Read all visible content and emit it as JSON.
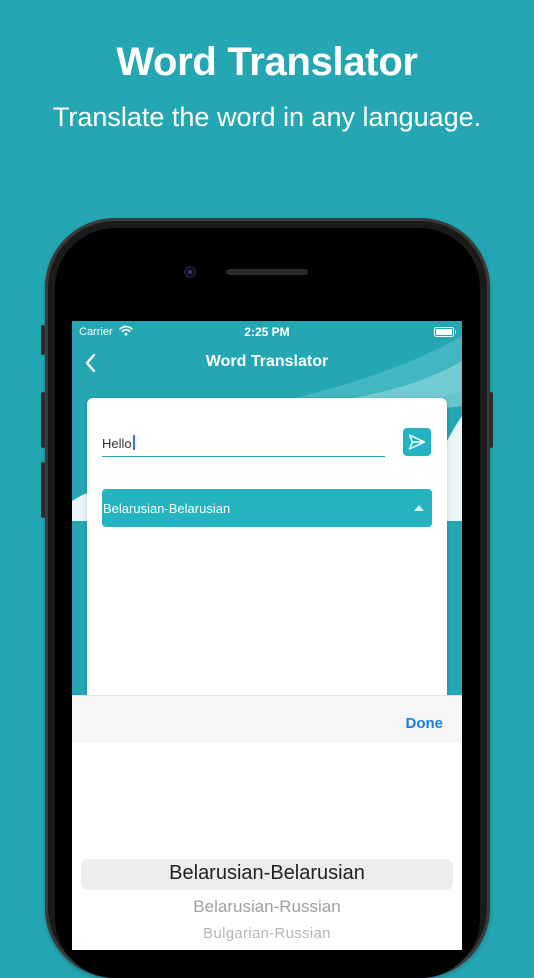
{
  "promo": {
    "title": "Word Translator",
    "subtitle": "Translate the word in any language."
  },
  "status_bar": {
    "carrier": "Carrier",
    "time": "2:25 PM"
  },
  "nav": {
    "title": "Word Translator"
  },
  "form": {
    "word_value": "Hello",
    "selected_language": "Belarusian-Belarusian"
  },
  "picker": {
    "done_label": "Done",
    "options": [
      "Belarusian-Belarusian",
      "Belarusian-Russian",
      "Bulgarian-Russian"
    ]
  },
  "colors": {
    "background": "#24a7b3",
    "accent": "#24b3c1",
    "done": "#1a7de3"
  },
  "icons": [
    "wifi-icon",
    "battery-icon",
    "back-chevron-icon",
    "send-icon",
    "dropdown-caret-icon"
  ]
}
